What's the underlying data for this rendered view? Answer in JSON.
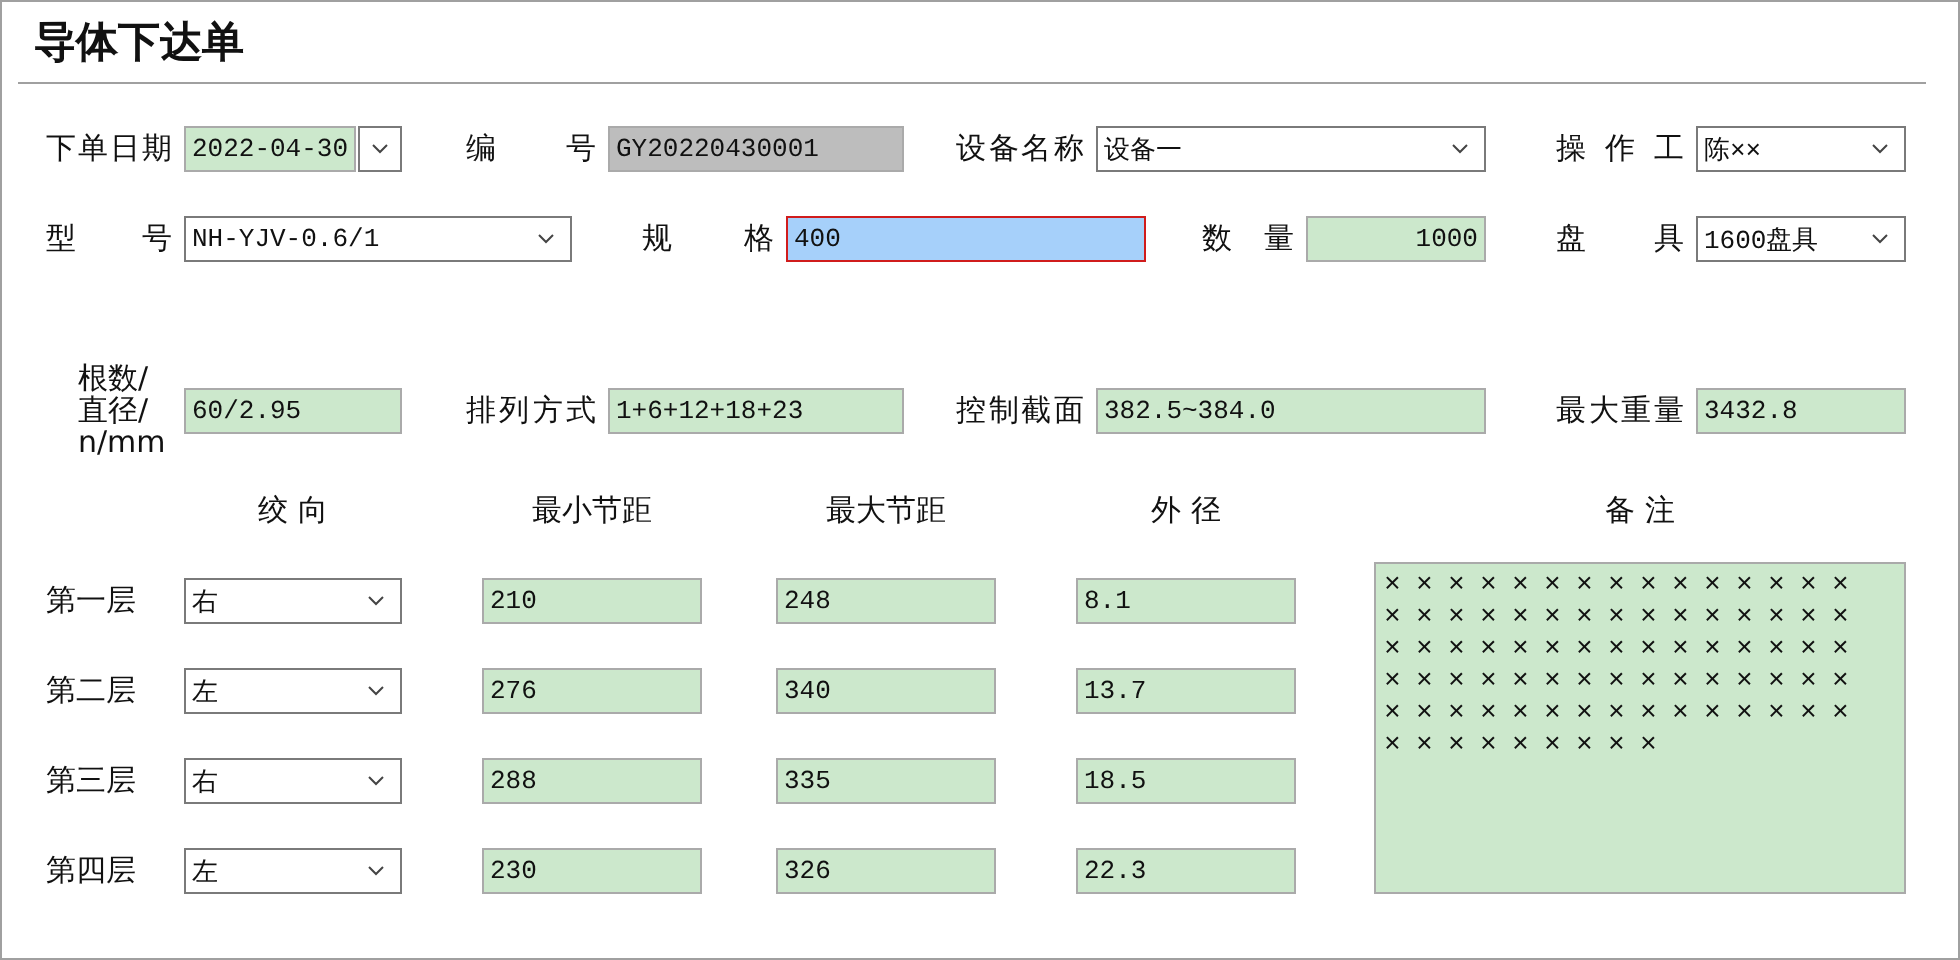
{
  "title": "导体下达单",
  "rows": [
    [
      {
        "label": "下单日期",
        "value": "2022-04-30",
        "kind": "date"
      },
      {
        "label": "编 号",
        "value": "GY20220430001",
        "kind": "readonly"
      },
      {
        "label": "设备名称",
        "value": "设备一",
        "kind": "dropdown"
      },
      {
        "label": "操 作 工",
        "value": "陈××",
        "kind": "dropdown"
      }
    ],
    [
      {
        "label": "型 号",
        "value": "NH-YJV-0.6/1",
        "kind": "dropdown"
      },
      {
        "label": "规 格",
        "value": "400",
        "kind": "active"
      },
      {
        "label": "数 量",
        "value": "1000",
        "kind": "number"
      },
      {
        "label": "盘 具",
        "value": "1600盘具",
        "kind": "dropdown"
      }
    ],
    [
      {
        "label": "根数/直径/n/mm",
        "value": "60/2.95",
        "kind": "text"
      },
      {
        "label": "排列方式",
        "value": "1+6+12+18+23",
        "kind": "text"
      },
      {
        "label": "控制截面",
        "value": "382.5~384.0",
        "kind": "text"
      },
      {
        "label": "最大重量",
        "value": "3432.8",
        "kind": "text"
      }
    ]
  ],
  "layers": {
    "columns": [
      "绞 向",
      "最小节距",
      "最大节距",
      "外 径"
    ],
    "rows": [
      {
        "label": "第一层",
        "direction": "右",
        "min_pitch": "210",
        "max_pitch": "248",
        "outer_diameter": "8.1"
      },
      {
        "label": "第二层",
        "direction": "左",
        "min_pitch": "276",
        "max_pitch": "340",
        "outer_diameter": "13.7"
      },
      {
        "label": "第三层",
        "direction": "右",
        "min_pitch": "288",
        "max_pitch": "335",
        "outer_diameter": "18.5"
      },
      {
        "label": "第四层",
        "direction": "左",
        "min_pitch": "230",
        "max_pitch": "326",
        "outer_diameter": "22.3"
      }
    ]
  },
  "remarks": {
    "label": "备 注",
    "value": "××××××××××××××××××××××××××××××××××××××××××××××××××××××××××××××××××××××××××××××××××××"
  }
}
